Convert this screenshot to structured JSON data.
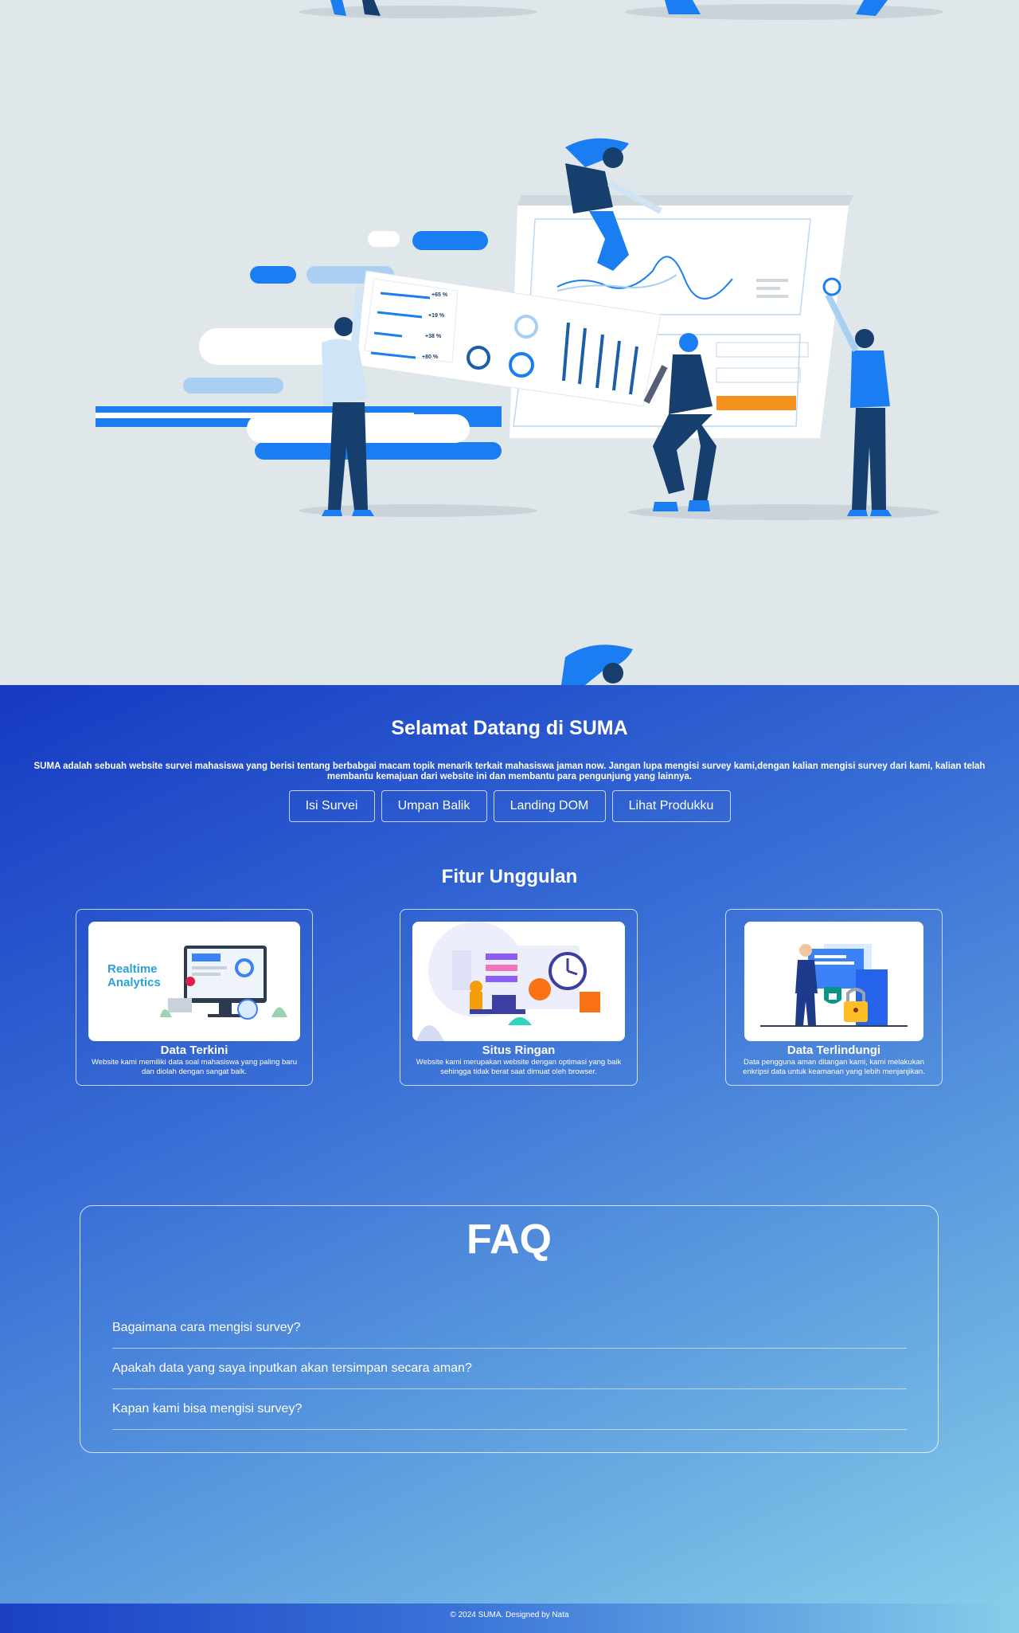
{
  "colors": {
    "hero_bg": "#dfe7ea",
    "gradient_start": "#1539c2",
    "gradient_end": "#86cdea",
    "accent_blue": "#1a7ef2",
    "accent_orange": "#f5921e",
    "navy": "#173f6e"
  },
  "hero": {
    "illustration": "data-dashboard-team-illustration",
    "card_labels": [
      "+65 %",
      "+19 %",
      "+38 %",
      "+80 %"
    ]
  },
  "welcome": {
    "title": "Selamat Datang di SUMA",
    "text": "SUMA adalah sebuah website survei mahasiswa yang berisi tentang berbabgai macam topik menarik terkait mahasiswa jaman now. Jangan lupa mengisi survey kami,dengan kalian mengisi survey dari kami, kalian telah membantu kemajuan dari website ini dan membantu para pengunjung yang lainnya.",
    "buttons": [
      "Isi Survei",
      "Umpan Balik",
      "Landing DOM",
      "Lihat Produkku"
    ]
  },
  "features": {
    "title": "Fitur Unggulan",
    "items": [
      {
        "title": "Data Terkini",
        "desc": "Website kami memiliki data soal mahasiswa yang paling baru dan diolah dengan sangat baik.",
        "thumb_text": "Realtime Analytics",
        "icon": "realtime-analytics-icon"
      },
      {
        "title": "Situs Ringan",
        "desc": "Website kami merupakan website dengan optimasi yang baik sehingga tidak berat saat dimuat oleh browser.",
        "icon": "lightweight-site-icon"
      },
      {
        "title": "Data Terlindungi",
        "desc": "Data pengguna aman ditangan kami, kami melakukan enkripsi data untuk keamanan yang lebih menjanjikan.",
        "icon": "security-guard-icon"
      }
    ]
  },
  "faq": {
    "title": "FAQ",
    "questions": [
      "Bagaimana cara mengisi survey?",
      "Apakah data yang saya inputkan akan tersimpan secara aman?",
      "Kapan kami bisa mengisi survey?"
    ]
  },
  "footer": {
    "text": "© 2024 SUMA. Designed by Nata"
  }
}
